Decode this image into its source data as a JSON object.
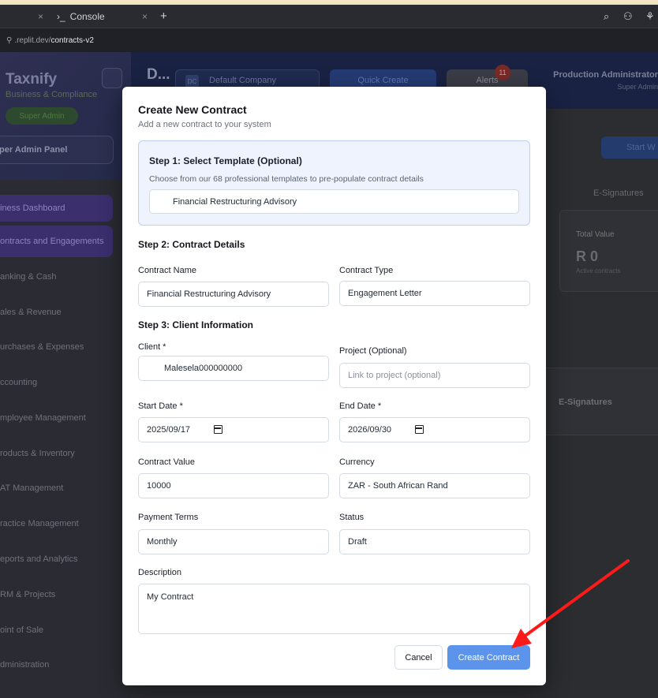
{
  "browser": {
    "tab_console": "Console",
    "url_prefix": ".replit.dev/",
    "url_path": "contracts-v2"
  },
  "sidebar": {
    "app_name": "Taxnify",
    "app_tagline": "Business & Compliance",
    "role_badge": "Super Admin",
    "panel_button": "per Admin Panel",
    "items": [
      {
        "label": "iness Dashboard"
      },
      {
        "label": "ontracts and Engagements"
      },
      {
        "label": "anking & Cash"
      },
      {
        "label": "ales & Revenue"
      },
      {
        "label": "urchases & Expenses"
      },
      {
        "label": "ccounting"
      },
      {
        "label": "mployee Management"
      },
      {
        "label": "roducts & Inventory"
      },
      {
        "label": "AT Management"
      },
      {
        "label": "ractice Management"
      },
      {
        "label": "eports and Analytics"
      },
      {
        "label": "RM & Projects"
      },
      {
        "label": "oint of Sale"
      },
      {
        "label": "dministration"
      }
    ]
  },
  "header": {
    "title": "D...",
    "company_initials": "DC",
    "company": "Default Company",
    "quick_create": "Quick Create",
    "alerts": "Alerts",
    "alert_count": "11",
    "user": "Production Administrator",
    "role": "Super Admin"
  },
  "background": {
    "start_button": "Start W",
    "esig_tab": "E-Signatures",
    "total_value_label": "Total Value",
    "total_value": "R 0",
    "total_value_sub": "Active contracts",
    "esig_row": "E-Signatures"
  },
  "modal": {
    "title": "Create New Contract",
    "subtitle": "Add a new contract to your system",
    "step1_title": "Step 1: Select Template (Optional)",
    "step1_desc": "Choose from our 68 professional templates to pre-populate contract details",
    "template_value": "Financial Restructuring Advisory",
    "step2_title": "Step 2: Contract Details",
    "contract_name_label": "Contract Name",
    "contract_name_value": "Financial Restructuring Advisory",
    "contract_type_label": "Contract Type",
    "contract_type_value": "Engagement Letter",
    "step3_title": "Step 3: Client Information",
    "client_label": "Client *",
    "client_value": "Malesela000000000",
    "project_label": "Project (Optional)",
    "project_placeholder": "Link to project (optional)",
    "start_date_label": "Start Date *",
    "start_date_value": "2025/09/17",
    "end_date_label": "End Date *",
    "end_date_value": "2026/09/30",
    "contract_value_label": "Contract Value",
    "contract_value_value": "10000",
    "currency_label": "Currency",
    "currency_value": "ZAR - South African Rand",
    "payment_terms_label": "Payment Terms",
    "payment_terms_value": "Monthly",
    "status_label": "Status",
    "status_value": "Draft",
    "description_label": "Description",
    "description_value": "My Contract",
    "cancel_label": "Cancel",
    "create_label": "Create Contract"
  },
  "annotation": {
    "arrow_color": "#ff1a1a"
  }
}
